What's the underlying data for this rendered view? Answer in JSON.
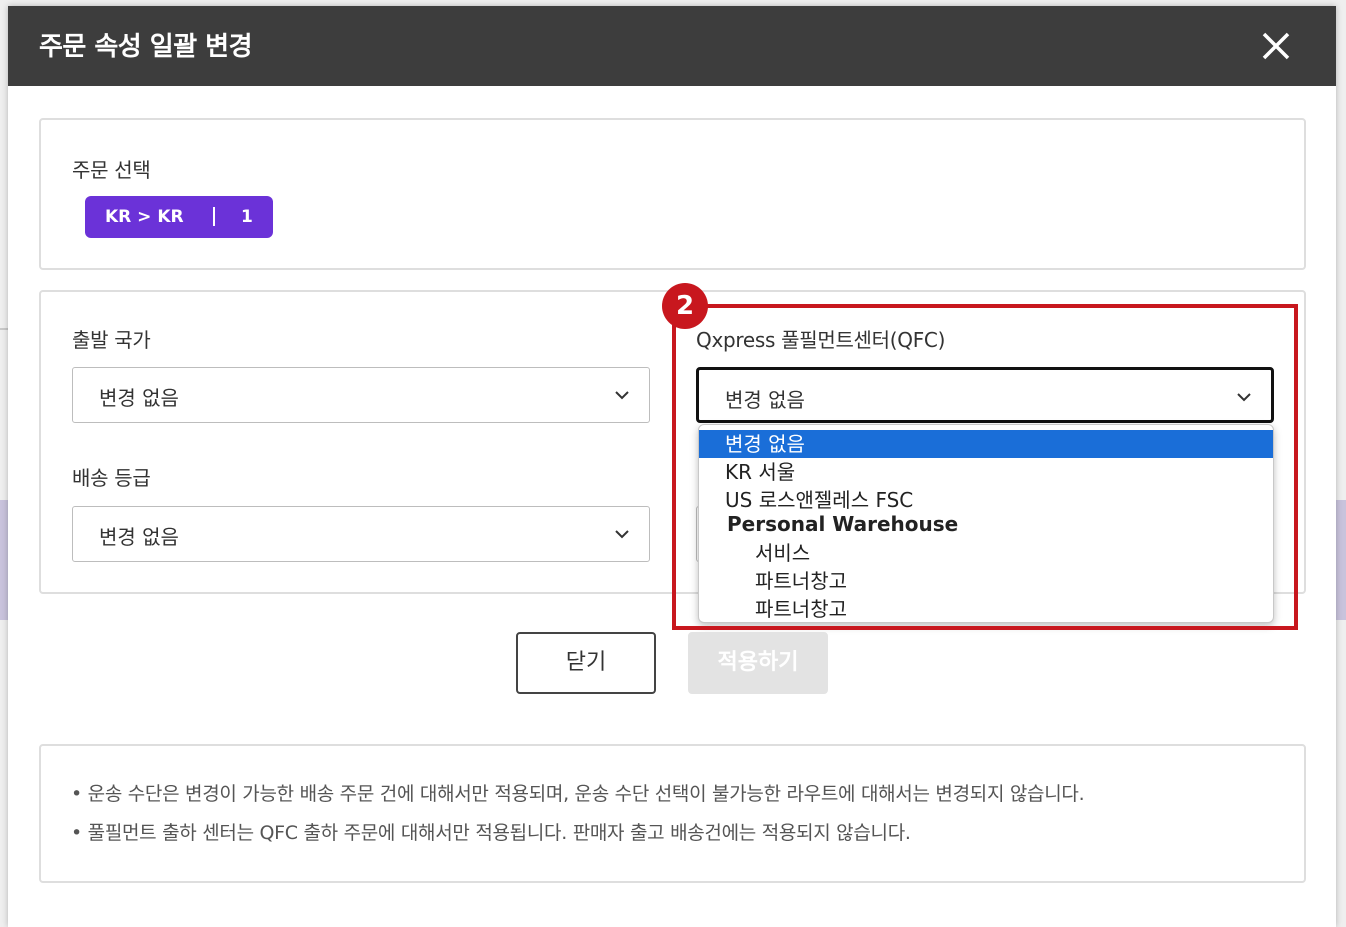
{
  "dialog": {
    "title": "주문 속성 일괄 변경",
    "close_icon": "close-icon"
  },
  "order_select": {
    "label": "주문 선택",
    "chip_route": "KR > KR",
    "chip_count": "1"
  },
  "departure_country": {
    "label": "출발 국가",
    "value": "변경 없음"
  },
  "shipping_grade": {
    "label": "배송 등급",
    "value": "변경 없음"
  },
  "qfc": {
    "label": "Qxpress 풀필먼트센터(QFC)",
    "value": "변경 없음",
    "options": [
      {
        "label": "변경 없음",
        "selected": true
      },
      {
        "label": "KR 서울"
      },
      {
        "label": "US 로스앤젤레스 FSC"
      }
    ],
    "group_label": "Personal Warehouse",
    "group_options": [
      {
        "label": "서비스"
      },
      {
        "label": "파트너창고"
      },
      {
        "label": "파트너창고"
      }
    ]
  },
  "step_badge": "2",
  "buttons": {
    "close_label": "닫기",
    "apply_label": "적용하기"
  },
  "notes": [
    "• 운송 수단은 변경이 가능한 배송 주문 건에 대해서만 적용되며, 운송 수단 선택이 불가능한 라우트에 대해서는 변경되지 않습니다.",
    "• 풀필먼트 출하 센터는 QFC 출하 주문에 대해서만 적용됩니다. 판매자 출고 배송건에는 적용되지 않습니다."
  ],
  "colors": {
    "header_bg": "#3d3d3d",
    "chip_bg": "#6b32d8",
    "selected_option": "#1a6ed8",
    "highlight": "#c8171e"
  }
}
